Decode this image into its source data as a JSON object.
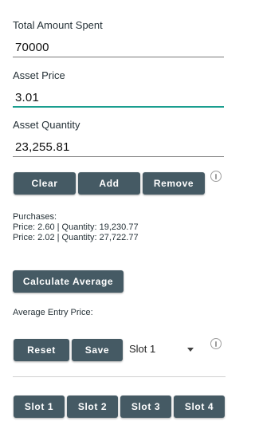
{
  "form": {
    "total_label": "Total Amount Spent",
    "total_value": "70000",
    "price_label": "Asset Price",
    "price_value": "3.01",
    "quantity_label": "Asset Quantity",
    "quantity_value": "23,255.81"
  },
  "actions": {
    "clear": "Clear",
    "add": "Add",
    "remove": "Remove"
  },
  "purchases": {
    "heading": "Purchases:",
    "items": [
      "Price: 2.60 | Quantity: 19,230.77",
      "Price: 2.02 | Quantity: 27,722.77"
    ]
  },
  "calculate_label": "Calculate Average",
  "average_label": "Average Entry Price:",
  "slot_actions": {
    "reset": "Reset",
    "save": "Save",
    "selected_slot": "Slot 1"
  },
  "slots": [
    "Slot 1",
    "Slot 2",
    "Slot 3",
    "Slot 4"
  ],
  "colors": {
    "button": "#455a64",
    "focus_underline": "#1a9e8f"
  },
  "icons": {
    "info": "info-circle-icon",
    "dropdown": "chevron-down-icon"
  }
}
